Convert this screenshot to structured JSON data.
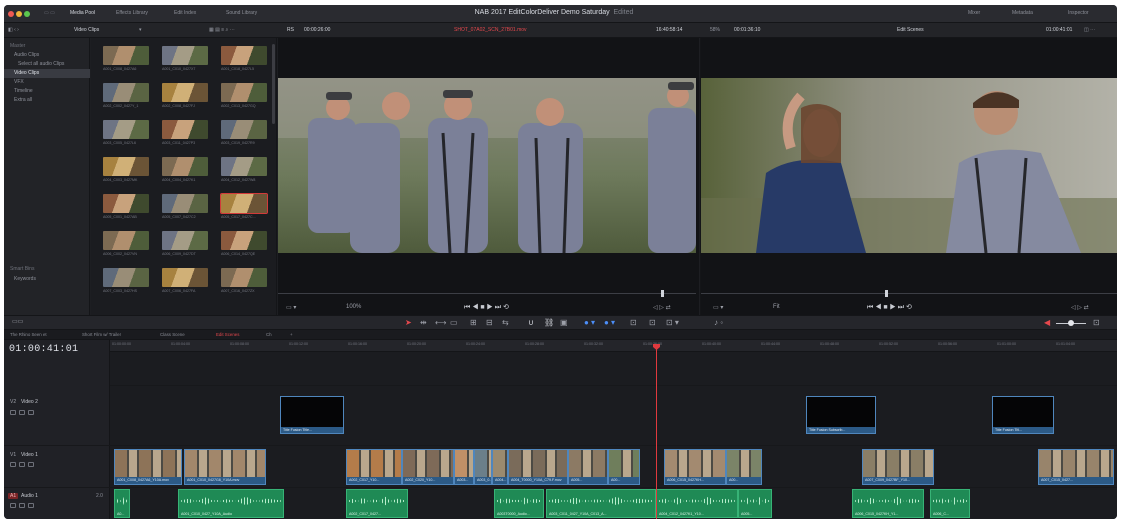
{
  "titlebar": {
    "items": [
      "Media Pool",
      "Effects Library",
      "Edit Index",
      "Sound Library"
    ],
    "project_title": "NAB 2017 EditColorDeliver Demo Saturday",
    "project_status": "Edited",
    "right_items": [
      "Mixer",
      "Metadata",
      "Inspector"
    ]
  },
  "toolbar": {
    "bin_title": "Video Clips",
    "source_timecode_label": "RS",
    "source_timecode": "00:00:26:00",
    "source_clip_name": "SHOT_07A02_SCN_27B01.mov",
    "source_time": "16:40:58:14",
    "zoom": "58%",
    "program_timecode": "00:01:36:10",
    "timeline_name": "Edit Scenes",
    "record_timecode": "01:00:41:01"
  },
  "bins": {
    "master_label": "Master",
    "items": [
      "Audio Clips",
      "Select all audio Clips",
      "Video Clips",
      "VFX",
      "Timeline",
      "Extra all"
    ],
    "selected": "Video Clips",
    "smart_bins_label": "Smart Bins",
    "smart_bins_items": [
      "Keywords"
    ]
  },
  "media_pool": {
    "rows": [
      [
        "A001_C008_0427A6",
        "A001_C010_0427X7",
        "A001_C018_0427L5"
      ],
      [
        "A002_C002_0427Y_1",
        "A002_C008_0427FJ",
        "A002_C013_0427GQ"
      ],
      [
        "A003_C005_0427L6",
        "A003_C011_0427P3",
        "A003_C019_0427R9"
      ],
      [
        "A004_C003_0427MK",
        "A004_C004_0427K1",
        "A004_C012_0427W8"
      ],
      [
        "A005_C001_0427AB",
        "A005_C007_0427C2",
        "A005_C017_0427C..."
      ],
      [
        "A006_C002_0427VN",
        "A006_C009_0427DT",
        "A006_C014_0427QE"
      ],
      [
        "A007_C003_0427HS",
        "A007_C006_0427FA",
        "A007_C016_0427ZX"
      ]
    ]
  },
  "source_viewer": {
    "in_point": "--:--:--:--",
    "zoom": "100%"
  },
  "program_viewer": {
    "zoom": "Fit",
    "tc": "--:--:--:--"
  },
  "timeline_tabs": [
    "The Rhino Seen et",
    "Short Film w/ Trailer",
    "Class Scene",
    "Edit Scenes",
    "Ch"
  ],
  "timeline_tabs_active": "Edit Scenes",
  "timeline": {
    "timecode": "01:00:41:01",
    "ruler_labels": [
      "01:00:00:00",
      "01:00:04:00",
      "01:00:08:00",
      "01:00:12:00",
      "01:00:16:00",
      "01:00:20:00",
      "01:00:24:00",
      "01:00:28:00",
      "01:00:32:00",
      "01:00:36:00",
      "01:00:40:00",
      "01:00:44:00",
      "01:00:48:00",
      "01:00:52:00",
      "01:00:56:00",
      "01:01:00:00",
      "01:01:04:00"
    ],
    "tracks": {
      "v2": {
        "id": "V2",
        "name": "Video 2"
      },
      "v1": {
        "id": "V1",
        "name": "Video 1"
      },
      "a1": {
        "id": "A1",
        "name": "Audio 1",
        "channel": "2.0"
      }
    },
    "title_clips": [
      "Title Fusion Title...",
      "Title Fusion Subscrib...",
      "Title Fusion Titl..."
    ],
    "video_clip_names": [
      "A001_C008_0427A6_Y10A.mov",
      "A001_C010_0427G8_Y10A.mov",
      "A002_C017_Y10...",
      "A002_C020_Y10...",
      "A003...",
      "A003_0...",
      "A004...",
      "A004_T0000_Y10A_C79.F.mov",
      "A005...",
      "A00...",
      "A006_C015_0427KH...",
      "A00...",
      "A007_C009_0427BF_Y10...",
      "A007_C015_0427..."
    ],
    "audio_clip_names": [
      "A0...",
      "A001_C010_0427_Y10A_Audio",
      "A002_C017_0427...",
      "A003T0000_Audio...",
      "A003_C011_0427_Y10A_C013_A...",
      "A004_C012_0427K1_Y10...",
      "A005...",
      "A006_C015_0427KH_Y1...",
      "A006_C..."
    ]
  }
}
